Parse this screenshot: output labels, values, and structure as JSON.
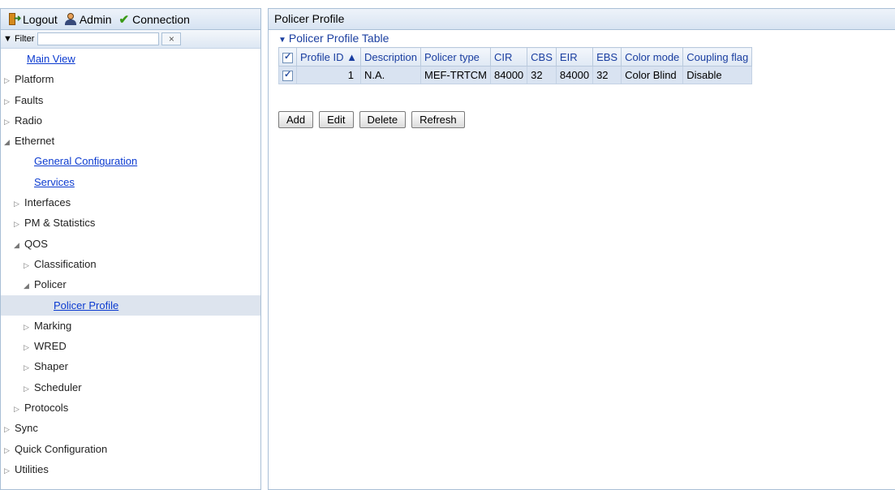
{
  "topbar": {
    "logout_label": "Logout",
    "admin_label": "Admin",
    "connection_label": "Connection"
  },
  "filter": {
    "label": "▼ Filter",
    "value": "",
    "clear": "×"
  },
  "tree": [
    {
      "label": "Main View",
      "indent": 0,
      "arrow": "",
      "link": true,
      "selected": false
    },
    {
      "label": "Platform",
      "indent": 0,
      "arrow": "▷",
      "link": false,
      "selected": false
    },
    {
      "label": "Faults",
      "indent": 0,
      "arrow": "▷",
      "link": false,
      "selected": false
    },
    {
      "label": "Radio",
      "indent": 0,
      "arrow": "▷",
      "link": false,
      "selected": false
    },
    {
      "label": "Ethernet",
      "indent": 0,
      "arrow": "◢",
      "link": false,
      "selected": false
    },
    {
      "label": "General Configuration",
      "indent": 2,
      "arrow": "",
      "link": true,
      "selected": false
    },
    {
      "label": "Services",
      "indent": 2,
      "arrow": "",
      "link": true,
      "selected": false
    },
    {
      "label": "Interfaces",
      "indent": 1,
      "arrow": "▷",
      "link": false,
      "selected": false
    },
    {
      "label": "PM & Statistics",
      "indent": 1,
      "arrow": "▷",
      "link": false,
      "selected": false
    },
    {
      "label": "QOS",
      "indent": 1,
      "arrow": "◢",
      "link": false,
      "selected": false
    },
    {
      "label": "Classification",
      "indent": 2,
      "arrow": "▷",
      "link": false,
      "selected": false
    },
    {
      "label": "Policer",
      "indent": 2,
      "arrow": "◢",
      "link": false,
      "selected": false
    },
    {
      "label": "Policer Profile",
      "indent": 4,
      "arrow": "",
      "link": true,
      "selected": true
    },
    {
      "label": "Marking",
      "indent": 2,
      "arrow": "▷",
      "link": false,
      "selected": false
    },
    {
      "label": "WRED",
      "indent": 2,
      "arrow": "▷",
      "link": false,
      "selected": false
    },
    {
      "label": "Shaper",
      "indent": 2,
      "arrow": "▷",
      "link": false,
      "selected": false
    },
    {
      "label": "Scheduler",
      "indent": 2,
      "arrow": "▷",
      "link": false,
      "selected": false
    },
    {
      "label": "Protocols",
      "indent": 1,
      "arrow": "▷",
      "link": false,
      "selected": false
    },
    {
      "label": "Sync",
      "indent": 0,
      "arrow": "▷",
      "link": false,
      "selected": false
    },
    {
      "label": "Quick Configuration",
      "indent": 0,
      "arrow": "▷",
      "link": false,
      "selected": false
    },
    {
      "label": "Utilities",
      "indent": 0,
      "arrow": "▷",
      "link": false,
      "selected": false
    }
  ],
  "main": {
    "title": "Policer Profile",
    "section_title": "Policer Profile Table",
    "columns": [
      "Profile ID ▲",
      "Description",
      "Policer type",
      "CIR",
      "CBS",
      "EIR",
      "EBS",
      "Color mode",
      "Coupling flag"
    ],
    "rows": [
      {
        "checked": true,
        "cells": [
          "1",
          "N.A.",
          "MEF-TRTCM",
          "84000",
          "32",
          "84000",
          "32",
          "Color Blind",
          "Disable"
        ]
      }
    ],
    "buttons": {
      "add": "Add",
      "edit": "Edit",
      "delete": "Delete",
      "refresh": "Refresh"
    }
  },
  "colors": {
    "link": "#0c3bd0",
    "selected_row": "#dde4ee",
    "header_text": "#1a3ea0"
  }
}
